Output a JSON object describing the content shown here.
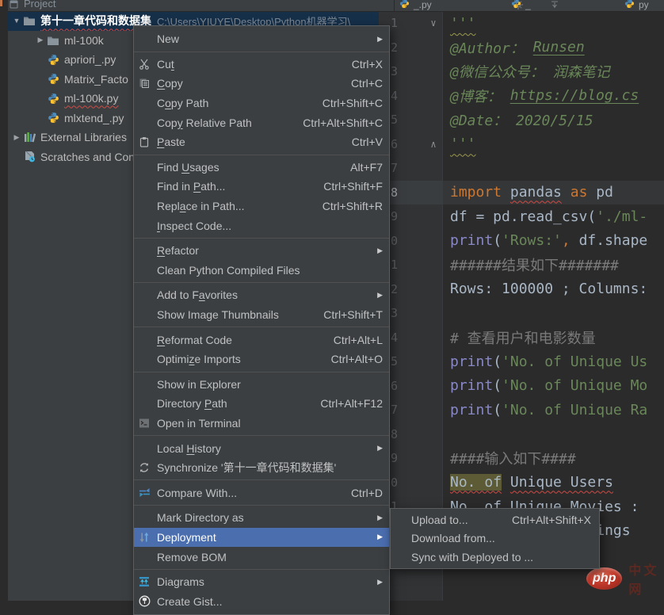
{
  "project_panel": {
    "header": {
      "title": "Project"
    },
    "tree": {
      "root": {
        "label": "第十一章代码和数据集",
        "path": "C:\\Users\\YIUYE\\Desktop\\Python机器学习\\"
      },
      "items": [
        {
          "label": "ml-100k",
          "icon": "folder-icon",
          "level": 1,
          "expandable": true
        },
        {
          "label": "apriori_.py",
          "icon": "python-icon",
          "level": 1
        },
        {
          "label": "Matrix_Facto",
          "icon": "python-icon",
          "level": 1
        },
        {
          "label": "ml-100k.py",
          "icon": "python-icon",
          "level": 1,
          "error": true
        },
        {
          "label": "mlxtend_.py",
          "icon": "python-icon",
          "level": 1
        },
        {
          "label": "External Libraries",
          "icon": "libraries-icon",
          "level": 0,
          "expandable": true
        },
        {
          "label": "Scratches and Consoles",
          "icon": "scratches-icon",
          "level": 0
        }
      ]
    }
  },
  "editor_tabs": {
    "fragments": [
      {
        "label": "_.py"
      },
      {
        "label": "_"
      },
      {
        "label": "py"
      }
    ]
  },
  "context_menu": {
    "items": [
      {
        "label": "New",
        "submenu": true
      },
      {
        "type": "separator"
      },
      {
        "label": "Cut",
        "shortcut": "Ctrl+X",
        "icon": "cut-icon",
        "mnemonic": 2
      },
      {
        "label": "Copy",
        "shortcut": "Ctrl+C",
        "icon": "copy-icon",
        "mnemonic": 0
      },
      {
        "label": "Copy Path",
        "shortcut": "Ctrl+Shift+C",
        "mnemonic": 1
      },
      {
        "label": "Copy Relative Path",
        "shortcut": "Ctrl+Alt+Shift+C",
        "mnemonic": 3
      },
      {
        "label": "Paste",
        "shortcut": "Ctrl+V",
        "icon": "paste-icon",
        "mnemonic": 0
      },
      {
        "type": "separator"
      },
      {
        "label": "Find Usages",
        "shortcut": "Alt+F7",
        "mnemonic": 5
      },
      {
        "label": "Find in Path...",
        "shortcut": "Ctrl+Shift+F",
        "mnemonic": 8
      },
      {
        "label": "Replace in Path...",
        "shortcut": "Ctrl+Shift+R",
        "mnemonic": 4
      },
      {
        "label": "Inspect Code...",
        "mnemonic": 0
      },
      {
        "type": "separator"
      },
      {
        "label": "Refactor",
        "submenu": true,
        "mnemonic": 0
      },
      {
        "label": "Clean Python Compiled Files"
      },
      {
        "type": "separator"
      },
      {
        "label": "Add to Favorites",
        "submenu": true,
        "mnemonic": 8
      },
      {
        "label": "Show Image Thumbnails",
        "shortcut": "Ctrl+Shift+T"
      },
      {
        "type": "separator"
      },
      {
        "label": "Reformat Code",
        "shortcut": "Ctrl+Alt+L",
        "mnemonic": 0
      },
      {
        "label": "Optimize Imports",
        "shortcut": "Ctrl+Alt+O",
        "mnemonic": 6
      },
      {
        "type": "separator"
      },
      {
        "label": "Show in Explorer"
      },
      {
        "label": "Directory Path",
        "shortcut": "Ctrl+Alt+F12",
        "mnemonic": 10
      },
      {
        "label": "Open in Terminal",
        "icon": "terminal-icon"
      },
      {
        "type": "separator"
      },
      {
        "label": "Local History",
        "submenu": true,
        "mnemonic": 6
      },
      {
        "label": "Synchronize '第十一章代码和数据集'",
        "icon": "sync-icon"
      },
      {
        "type": "separator"
      },
      {
        "label": "Compare With...",
        "shortcut": "Ctrl+D",
        "icon": "compare-icon"
      },
      {
        "type": "separator"
      },
      {
        "label": "Mark Directory as",
        "submenu": true
      },
      {
        "label": "Deployment",
        "icon": "deployment-icon",
        "submenu": true,
        "selected": true
      },
      {
        "label": "Remove BOM"
      },
      {
        "type": "separator"
      },
      {
        "label": "Diagrams",
        "icon": "diagrams-icon",
        "submenu": true
      },
      {
        "label": "Create Gist...",
        "icon": "gist-icon"
      }
    ]
  },
  "deployment_submenu": {
    "items": [
      {
        "label": "Upload to...",
        "shortcut": "Ctrl+Alt+Shift+X"
      },
      {
        "label": "Download from..."
      },
      {
        "label": "Sync with Deployed to ..."
      }
    ]
  },
  "editor": {
    "lines": [
      {
        "fold": "∨",
        "segments": [
          [
            "'''",
            "docw"
          ]
        ]
      },
      {
        "segments": [
          [
            "@Author： ",
            "doc"
          ],
          [
            "Runsen",
            "link"
          ]
        ]
      },
      {
        "segments": [
          [
            "@微信公众号： 润森笔记",
            "doc"
          ]
        ]
      },
      {
        "segments": [
          [
            "@博客： ",
            "doc"
          ],
          [
            "https://blog.cs",
            "link"
          ]
        ]
      },
      {
        "segments": [
          [
            "@Date： 2020/5/15",
            "doc"
          ]
        ]
      },
      {
        "fold": "∧",
        "segments": [
          [
            "'''",
            "docw"
          ]
        ]
      },
      {
        "segments": []
      },
      {
        "current": true,
        "segments": [
          [
            "import",
            "kw"
          ],
          [
            " ",
            "plain"
          ],
          [
            "pandas",
            "err"
          ],
          [
            " ",
            "plain"
          ],
          [
            "as",
            "kw"
          ],
          [
            " pd",
            "plain"
          ]
        ]
      },
      {
        "segments": [
          [
            "df = pd.read_csv(",
            "plain"
          ],
          [
            "'./ml-",
            "str"
          ]
        ]
      },
      {
        "segments": [
          [
            "print",
            "builtin"
          ],
          [
            "(",
            "plain"
          ],
          [
            "'Rows:'",
            "str"
          ],
          [
            ",",
            "comma"
          ],
          [
            " df.shape",
            "plain"
          ]
        ]
      },
      {
        "segments": [
          [
            "######结果如下#######",
            "comment"
          ]
        ]
      },
      {
        "segments": [
          [
            "Rows: 100000 ; Columns:",
            "plain"
          ]
        ]
      },
      {
        "segments": []
      },
      {
        "segments": [
          [
            "# 查看用户和电影数量",
            "comment"
          ]
        ]
      },
      {
        "segments": [
          [
            "print",
            "builtin"
          ],
          [
            "(",
            "plain"
          ],
          [
            "'No. of Unique Us",
            "str"
          ]
        ]
      },
      {
        "segments": [
          [
            "print",
            "builtin"
          ],
          [
            "(",
            "plain"
          ],
          [
            "'No. of Unique Mo",
            "str"
          ]
        ]
      },
      {
        "segments": [
          [
            "print",
            "builtin"
          ],
          [
            "(",
            "plain"
          ],
          [
            "'No. of Unique Ra",
            "str"
          ]
        ]
      },
      {
        "segments": []
      },
      {
        "segments": [
          [
            "####输入如下####",
            "comment"
          ]
        ]
      },
      {
        "segments": [
          [
            "No. of",
            "hl"
          ],
          [
            " ",
            "plain"
          ],
          [
            "Unique Users",
            "wavy"
          ]
        ]
      },
      {
        "segments": [
          [
            "No. of Unique Movies :",
            "plain"
          ]
        ]
      },
      {
        "segments": [
          [
            "No. of Unique Ratings",
            "plain"
          ]
        ]
      },
      {
        "segments": []
      }
    ]
  },
  "watermark": {
    "brand": "php",
    "suffix": "中文网"
  },
  "colors": {
    "menu_selection": "#4B6EAF",
    "tree_selection": "#16304A",
    "search_highlight": "#5C5B35",
    "editor_bg": "#2B2B2B",
    "panel_bg": "#3C3F41"
  }
}
